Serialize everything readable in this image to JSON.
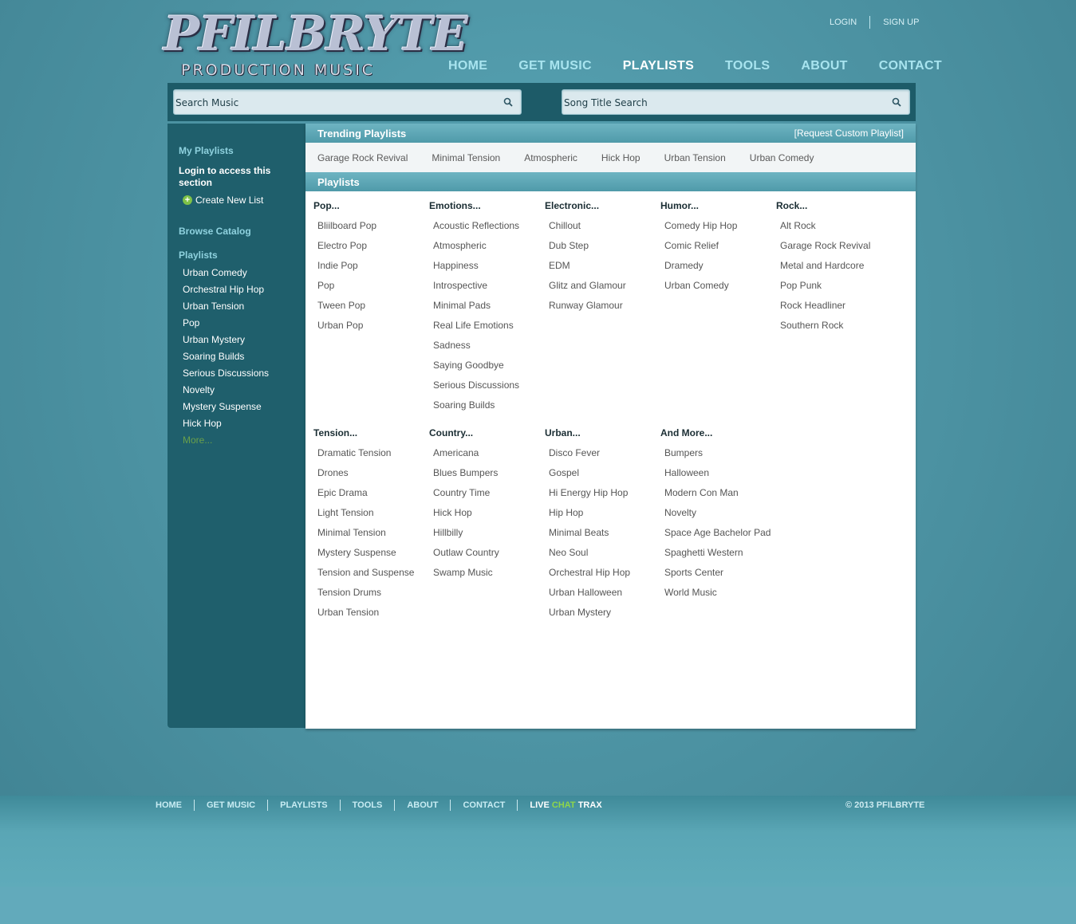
{
  "logo": {
    "main": "PFILBRYTE",
    "sub": "PRODUCTION MUSIC"
  },
  "top_links": {
    "login": "LOGIN",
    "signup": "SIGN UP"
  },
  "nav": [
    {
      "label": "HOME"
    },
    {
      "label": "GET MUSIC"
    },
    {
      "label": "PLAYLISTS",
      "active": true
    },
    {
      "label": "TOOLS"
    },
    {
      "label": "ABOUT"
    },
    {
      "label": "CONTACT"
    }
  ],
  "search": {
    "music_placeholder": "Search Music",
    "title_placeholder": "Song Title Search"
  },
  "sidebar": {
    "my_playlists": "My Playlists",
    "login_note": "Login to access this section",
    "create_new": "Create New List",
    "browse_catalog": "Browse Catalog",
    "playlists_heading": "Playlists",
    "playlists": [
      "Urban Comedy",
      "Orchestral Hip Hop",
      "Urban Tension",
      "Pop",
      "Urban Mystery",
      "Soaring Builds",
      "Serious Discussions",
      "Novelty",
      "Mystery Suspense",
      "Hick Hop"
    ],
    "more": "More..."
  },
  "trending": {
    "title": "Trending Playlists",
    "request": "[Request Custom Playlist]",
    "items": [
      "Garage Rock Revival",
      "Minimal Tension",
      "Atmospheric",
      "Hick Hop",
      "Urban Tension",
      "Urban Comedy"
    ]
  },
  "playlists": {
    "title": "Playlists",
    "groups": [
      {
        "heading": "Pop...",
        "items": [
          "Bliilboard Pop",
          "Electro Pop",
          "Indie Pop",
          "Pop",
          "Tween Pop",
          "Urban Pop"
        ]
      },
      {
        "heading": "Emotions...",
        "items": [
          "Acoustic Reflections",
          "Atmospheric",
          "Happiness",
          "Introspective",
          "Minimal Pads",
          "Real Life Emotions",
          "Sadness",
          "Saying Goodbye",
          "Serious Discussions",
          "Soaring Builds"
        ]
      },
      {
        "heading": "Electronic...",
        "items": [
          "Chillout",
          "Dub Step",
          "EDM",
          "Glitz and Glamour",
          "Runway Glamour"
        ]
      },
      {
        "heading": "Humor...",
        "items": [
          "Comedy Hip Hop",
          "Comic Relief",
          "Dramedy",
          "Urban Comedy"
        ]
      },
      {
        "heading": "Rock...",
        "items": [
          "Alt Rock",
          "Garage Rock Revival",
          "Metal and Hardcore",
          "Pop Punk",
          "Rock Headliner",
          "Southern Rock"
        ]
      },
      {
        "heading": "Tension...",
        "items": [
          "Dramatic Tension",
          "Drones",
          "Epic Drama",
          "Light Tension",
          "Minimal Tension",
          "Mystery Suspense",
          "Tension and Suspense",
          "Tension Drums",
          "Urban Tension"
        ]
      },
      {
        "heading": "Country...",
        "items": [
          "Americana",
          "Blues Bumpers",
          "Country Time",
          "Hick Hop",
          "Hillbilly",
          "Outlaw Country",
          "Swamp Music"
        ]
      },
      {
        "heading": "Urban...",
        "items": [
          "Disco Fever",
          "Gospel",
          "Hi Energy Hip Hop",
          "Hip Hop",
          "Minimal Beats",
          "Neo Soul",
          "Orchestral Hip Hop",
          "Urban Halloween",
          "Urban Mystery"
        ]
      },
      {
        "heading": "And More...",
        "items": [
          "Bumpers",
          "Halloween",
          "Modern Con Man",
          "Novelty",
          "Space Age Bachelor Pad",
          "Spaghetti Western",
          "Sports Center",
          "World Music"
        ]
      }
    ]
  },
  "footer": {
    "links": [
      "HOME",
      "GET MUSIC",
      "PLAYLISTS",
      "TOOLS",
      "ABOUT",
      "CONTACT"
    ],
    "live": "LIVE",
    "chat": "CHAT",
    "trax": "TRAX",
    "copyright": "© 2013 PFILBRYTE"
  },
  "colors": {
    "accent": "#8fd2df",
    "sidebar_bg": "#1f5f6c",
    "bar": "#5aa6b5",
    "chat_green": "#8fd64a"
  }
}
